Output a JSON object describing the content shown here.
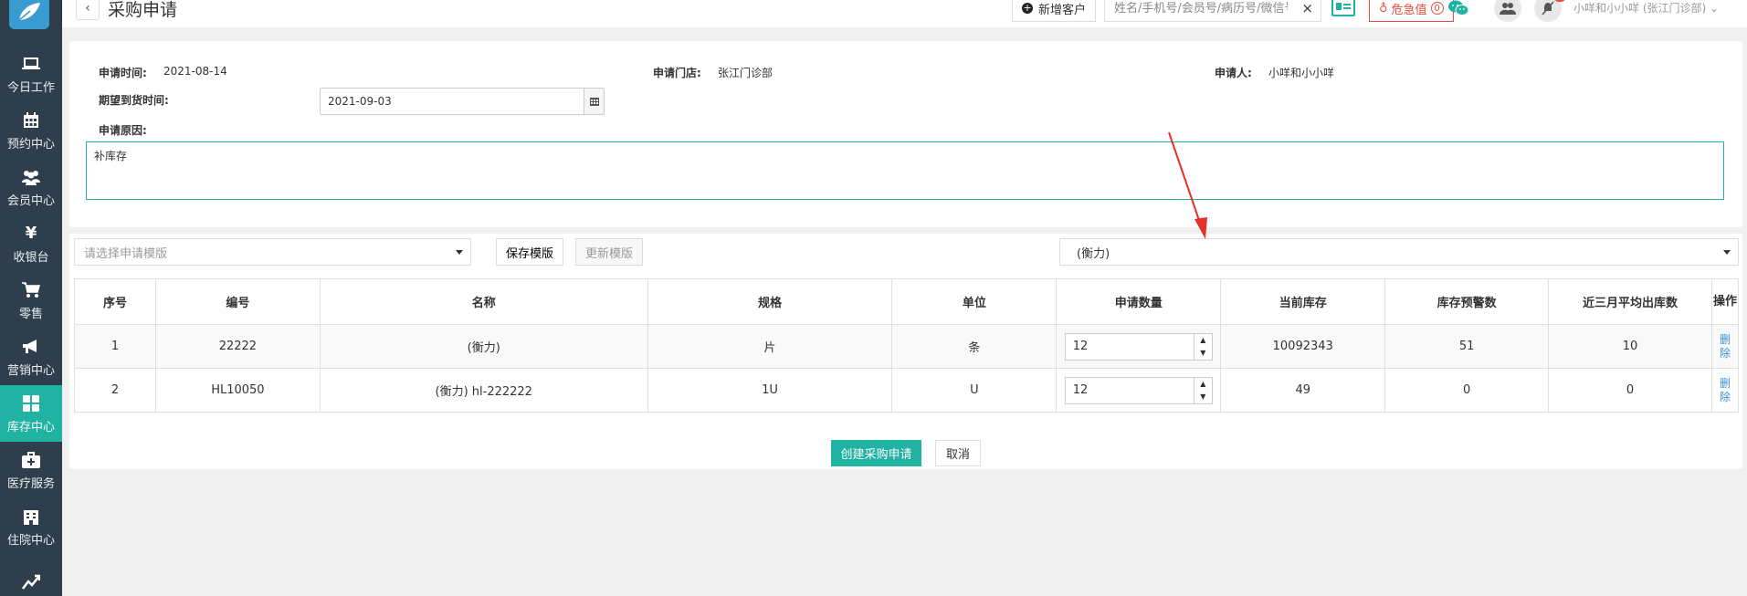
{
  "header": {
    "title": "采购申请",
    "back_icon": "‹",
    "new_customer_label": "新增客户",
    "search_placeholder": "姓名/手机号/会员号/病历号/微信号",
    "clear_icon": "×",
    "danger_label": "危急值",
    "danger_count": "0",
    "user_label": "小咩和小小咩 (张江门诊部)"
  },
  "sidebar": {
    "items": [
      {
        "label": "今日工作",
        "icon": "laptop-icon"
      },
      {
        "label": "预约中心",
        "icon": "calendar-icon"
      },
      {
        "label": "会员中心",
        "icon": "users-icon"
      },
      {
        "label": "收银台",
        "icon": "yen-icon"
      },
      {
        "label": "零售",
        "icon": "cart-icon"
      },
      {
        "label": "营销中心",
        "icon": "megaphone-icon"
      },
      {
        "label": "库存中心",
        "icon": "grid-icon"
      },
      {
        "label": "医疗服务",
        "icon": "medkit-icon"
      },
      {
        "label": "住院中心",
        "icon": "hospital-icon"
      },
      {
        "label": "",
        "icon": "chart-icon"
      }
    ],
    "active_index": 6
  },
  "form": {
    "apply_time_label": "申请时间:",
    "apply_time_value": "2021-08-14",
    "store_label": "申请门店:",
    "store_value": "张江门诊部",
    "applicant_label": "申请人:",
    "applicant_value": "小咩和小小咩",
    "expected_label": "期望到货时间:",
    "expected_value": "2021-09-03",
    "reason_label": "申请原因:",
    "reason_value": "补库存"
  },
  "toolbar": {
    "template_placeholder": "请选择申请模版",
    "save_template_label": "保存模版",
    "update_template_label": "更新模版",
    "item_select_value": "(衡力)"
  },
  "table": {
    "headers": [
      "序号",
      "编号",
      "名称",
      "规格",
      "单位",
      "申请数量",
      "当前库存",
      "库存预警数",
      "近三月平均出库数",
      "操作"
    ],
    "rows": [
      {
        "no": "1",
        "code": "22222",
        "name": "(衡力)",
        "spec": "片",
        "unit": "条",
        "qty": "12",
        "stock": "10092343",
        "warn": "51",
        "avg": "10",
        "action": "删除"
      },
      {
        "no": "2",
        "code": "HL10050",
        "name": "(衡力) hl-222222",
        "spec": "1U",
        "unit": "U",
        "qty": "12",
        "stock": "49",
        "warn": "0",
        "avg": "0",
        "action": "删除"
      }
    ]
  },
  "actions": {
    "create_label": "创建采购申请",
    "cancel_label": "取消"
  },
  "colors": {
    "accent": "#20b2a3",
    "sidebar_bg": "#2f3e4c",
    "danger": "#e74c3c",
    "link": "#3a8fd8"
  }
}
